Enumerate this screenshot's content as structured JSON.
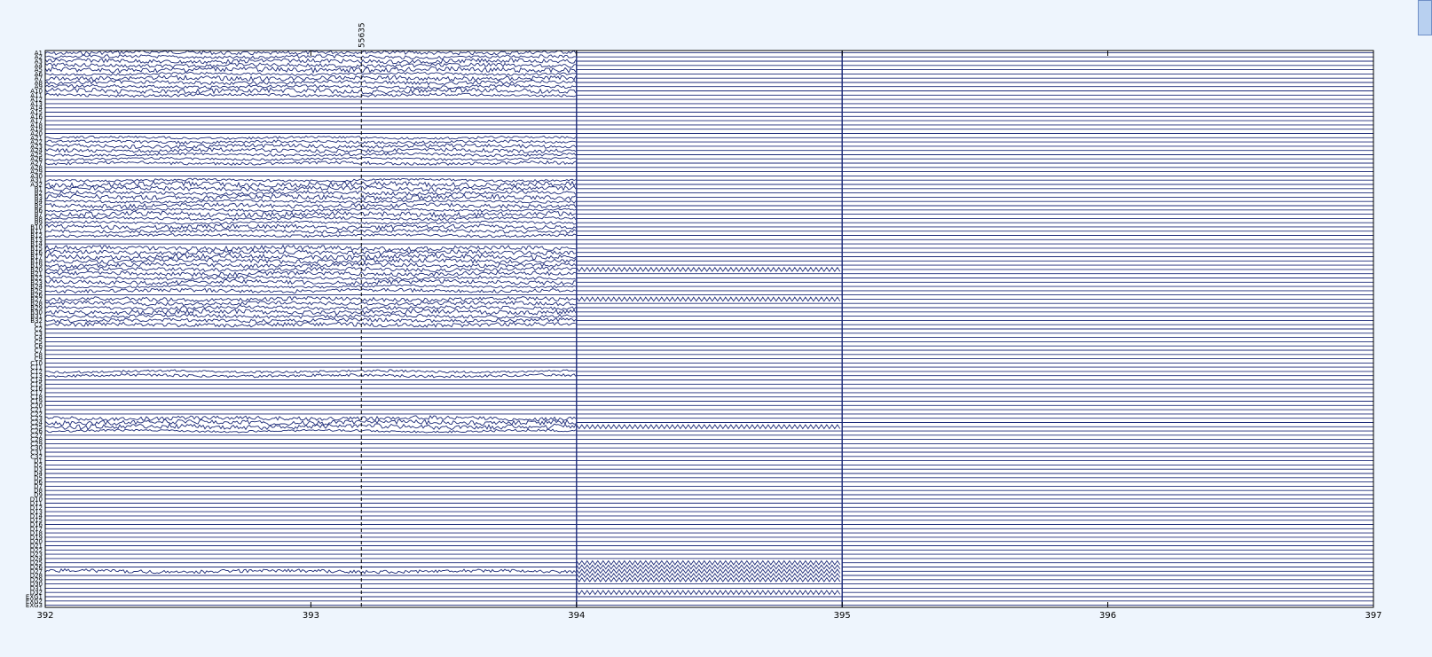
{
  "chart_data": {
    "type": "line",
    "title": "",
    "xlabel": "",
    "ylabel": "",
    "xlim": [
      392,
      397
    ],
    "x_ticks": [
      "392",
      "393",
      "394",
      "395",
      "396",
      "397"
    ],
    "cursor": {
      "x": 393.19,
      "label": "55635"
    },
    "channels": [
      "A1",
      "A2",
      "A3",
      "A4",
      "A5",
      "A6",
      "A7",
      "A8",
      "A9",
      "A10",
      "A11",
      "A12",
      "A13",
      "A14",
      "A15",
      "A16",
      "A17",
      "A18",
      "A19",
      "A20",
      "A21",
      "A22",
      "A23",
      "A24",
      "A25",
      "A26",
      "A27",
      "A28",
      "A29",
      "A30",
      "A31",
      "A32",
      "B1",
      "B2",
      "B3",
      "B4",
      "B5",
      "B6",
      "B7",
      "B8",
      "B9",
      "B10",
      "B11",
      "B12",
      "B13",
      "B14",
      "B15",
      "B16",
      "B17",
      "B18",
      "B19",
      "B20",
      "B21",
      "B22",
      "B23",
      "B24",
      "B25",
      "B26",
      "B27",
      "B28",
      "B29",
      "B30",
      "B31",
      "B32",
      "C1",
      "C2",
      "C3",
      "C4",
      "C5",
      "C6",
      "C7",
      "C8",
      "C9",
      "C10",
      "C11",
      "C12",
      "C13",
      "C14",
      "C15",
      "C16",
      "C17",
      "C18",
      "C19",
      "C20",
      "C21",
      "C22",
      "C23",
      "C24",
      "C25",
      "C26",
      "C27",
      "C28",
      "C29",
      "C30",
      "C31",
      "C32",
      "D1",
      "D2",
      "D3",
      "D4",
      "D5",
      "D6",
      "D7",
      "D8",
      "D9",
      "D10",
      "D11",
      "D12",
      "D13",
      "D14",
      "D15",
      "D16",
      "D17",
      "D18",
      "D19",
      "D20",
      "D21",
      "D22",
      "D23",
      "D24",
      "D25",
      "D26",
      "D27",
      "D28",
      "D29",
      "D30",
      "D31",
      "D32",
      "EXG1",
      "EXG2",
      "EXG3"
    ],
    "segments": [
      {
        "x_from": 392,
        "x_to": 394,
        "style": "eeg",
        "noisy_channels": [
          0,
          1,
          2,
          3,
          4,
          5,
          6,
          7,
          8,
          9,
          10,
          20,
          21,
          22,
          23,
          24,
          25,
          26,
          30,
          31,
          32,
          33,
          34,
          35,
          36,
          37,
          38,
          39,
          40,
          41,
          42,
          43,
          46,
          47,
          48,
          49,
          50,
          51,
          52,
          53,
          54,
          55,
          56,
          58,
          59,
          60,
          61,
          62,
          63,
          64,
          75,
          76,
          86,
          87,
          88,
          89,
          122
        ]
      },
      {
        "x_from": 394,
        "x_to": 395,
        "style": "mixed",
        "oscillating_channels": [
          51,
          58,
          88,
          120,
          121,
          122,
          123,
          124,
          127
        ]
      },
      {
        "x_from": 395,
        "x_to": 397,
        "style": "flat"
      }
    ]
  },
  "colors": {
    "trace": "#1c2a78",
    "axes": "#000000",
    "background": "#ffffff",
    "page": "#eef5fd"
  }
}
